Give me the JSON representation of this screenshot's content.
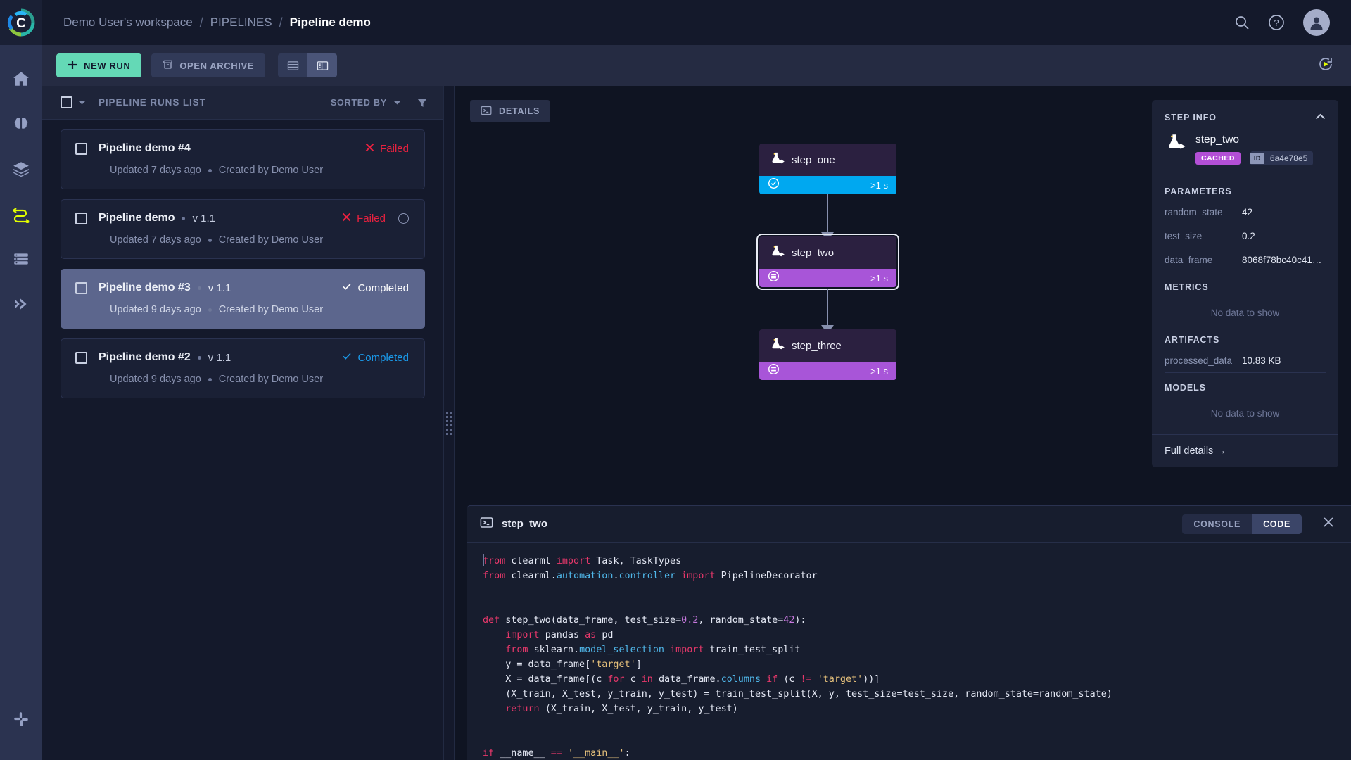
{
  "header": {
    "logo_icon": "clearml-logo-icon",
    "breadcrumb": [
      "Demo User's workspace",
      "PIPELINES",
      "Pipeline demo"
    ],
    "separator": "/",
    "search_icon": "search-icon",
    "help_icon": "help-circle-icon",
    "avatar_icon": "user-avatar-icon"
  },
  "rail": {
    "items": [
      {
        "name": "home",
        "icon": "home-icon",
        "active": false
      },
      {
        "name": "projects",
        "icon": "brain-icon",
        "active": false
      },
      {
        "name": "datasets",
        "icon": "layers-icon",
        "active": false
      },
      {
        "name": "pipelines",
        "icon": "pipelines-icon",
        "active": true
      },
      {
        "name": "workers",
        "icon": "server-icon",
        "active": false
      },
      {
        "name": "reports",
        "icon": "double-chevron-icon",
        "active": false
      }
    ],
    "bottom": {
      "name": "integrations",
      "icon": "slack-icon"
    }
  },
  "toolbar": {
    "new_run_label": "NEW RUN",
    "new_run_icon": "plus-icon",
    "open_archive_label": "OPEN ARCHIVE",
    "archive_icon": "archive-box-icon",
    "view_list_icon": "list-view-icon",
    "view_split_icon": "split-view-icon",
    "refresh_icon": "auto-refresh-icon"
  },
  "runs_panel": {
    "title": "PIPELINE RUNS LIST",
    "sorted_by_label": "SORTED BY",
    "sort_caret_icon": "chevron-down-icon",
    "filter_icon": "filter-icon",
    "select_all_icon": "checkbox-icon",
    "header_caret_icon": "chevron-down-icon",
    "runs": [
      {
        "name": "Pipeline demo #4",
        "version": "",
        "status": "Failed",
        "status_kind": "failed",
        "status_icon": "x-icon",
        "updated": "Updated 7 days ago",
        "created_by": "Created by Demo User",
        "selected": false,
        "spinner": false
      },
      {
        "name": "Pipeline demo",
        "version": "v 1.1",
        "status": "Failed",
        "status_kind": "failed",
        "status_icon": "x-icon",
        "updated": "Updated 7 days ago",
        "created_by": "Created by Demo User",
        "selected": false,
        "spinner": true
      },
      {
        "name": "Pipeline demo #3",
        "version": "v 1.1",
        "status": "Completed",
        "status_kind": "completed",
        "status_icon": "check-icon",
        "updated": "Updated 9 days ago",
        "created_by": "Created by Demo User",
        "selected": true,
        "spinner": false
      },
      {
        "name": "Pipeline demo #2",
        "version": "v 1.1",
        "status": "Completed",
        "status_kind": "completed",
        "status_icon": "check-icon",
        "updated": "Updated 9 days ago",
        "created_by": "Created by Demo User",
        "selected": false,
        "spinner": false
      }
    ]
  },
  "dag": {
    "details_label": "DETAILS",
    "details_icon": "console-icon",
    "nodes": [
      {
        "name": "step_one",
        "time": ">1 s",
        "bar_color": "#00a8f0",
        "bar_kind": "blue",
        "bar_icon": "check-circle-icon",
        "selected": false,
        "icon": "experiment-icon"
      },
      {
        "name": "step_two",
        "time": ">1 s",
        "bar_color": "#a855d8",
        "bar_kind": "purple",
        "bar_icon": "cached-icon",
        "selected": true,
        "icon": "experiment-icon"
      },
      {
        "name": "step_three",
        "time": ">1 s",
        "bar_color": "#a855d8",
        "bar_kind": "purple",
        "bar_icon": "cached-icon",
        "selected": false,
        "icon": "experiment-icon"
      }
    ]
  },
  "step_info": {
    "title": "STEP INFO",
    "collapse_icon": "chevron-up-icon",
    "task_icon": "experiment-icon",
    "task_name": "step_two",
    "badge": "CACHED",
    "badge_color": "#b34fd6",
    "id_key": "ID",
    "id_value": "6a4e78e5",
    "parameters_title": "PARAMETERS",
    "parameters": [
      {
        "key": "random_state",
        "value": "42"
      },
      {
        "key": "test_size",
        "value": "0.2"
      },
      {
        "key": "data_frame",
        "value": "8068f78bc40c41d…"
      }
    ],
    "metrics_title": "METRICS",
    "metrics_empty": "No data to show",
    "artifacts_title": "ARTIFACTS",
    "artifacts": [
      {
        "key": "processed_data",
        "value": "10.83 KB"
      }
    ],
    "models_title": "MODELS",
    "models_empty": "No data to show",
    "full_details_label": "Full details →"
  },
  "code_panel": {
    "icon": "console-icon",
    "title": "step_two",
    "tabs": [
      {
        "label": "CONSOLE",
        "active": false
      },
      {
        "label": "CODE",
        "active": true
      }
    ],
    "close_icon": "close-icon",
    "lines": [
      [
        {
          "t": "from ",
          "c": "kw"
        },
        {
          "t": "clearml ",
          "c": ""
        },
        {
          "t": "import ",
          "c": "kw"
        },
        {
          "t": "Task, TaskTypes",
          "c": ""
        }
      ],
      [
        {
          "t": "from ",
          "c": "kw"
        },
        {
          "t": "clearml.",
          "c": ""
        },
        {
          "t": "automation",
          "c": "mod"
        },
        {
          "t": ".",
          "c": ""
        },
        {
          "t": "controller ",
          "c": "mod"
        },
        {
          "t": "import ",
          "c": "kw"
        },
        {
          "t": "PipelineDecorator",
          "c": ""
        }
      ],
      [],
      [],
      [
        {
          "t": "def ",
          "c": "kw"
        },
        {
          "t": "step_two(data_frame, test_size=",
          "c": ""
        },
        {
          "t": "0.2",
          "c": "num"
        },
        {
          "t": ", random_state=",
          "c": ""
        },
        {
          "t": "42",
          "c": "num"
        },
        {
          "t": "):",
          "c": ""
        }
      ],
      [
        {
          "t": "    ",
          "c": ""
        },
        {
          "t": "import ",
          "c": "kw"
        },
        {
          "t": "pandas ",
          "c": ""
        },
        {
          "t": "as ",
          "c": "kw"
        },
        {
          "t": "pd",
          "c": ""
        }
      ],
      [
        {
          "t": "    ",
          "c": ""
        },
        {
          "t": "from ",
          "c": "kw"
        },
        {
          "t": "sklearn.",
          "c": ""
        },
        {
          "t": "model_selection ",
          "c": "mod"
        },
        {
          "t": "import ",
          "c": "kw"
        },
        {
          "t": "train_test_split",
          "c": ""
        }
      ],
      [
        {
          "t": "    y = data_frame[",
          "c": ""
        },
        {
          "t": "'target'",
          "c": "str"
        },
        {
          "t": "]",
          "c": ""
        }
      ],
      [
        {
          "t": "    X = data_frame[(c ",
          "c": ""
        },
        {
          "t": "for ",
          "c": "kw"
        },
        {
          "t": "c ",
          "c": ""
        },
        {
          "t": "in ",
          "c": "kw"
        },
        {
          "t": "data_frame.",
          "c": ""
        },
        {
          "t": "columns ",
          "c": "mod"
        },
        {
          "t": "if ",
          "c": "kw"
        },
        {
          "t": "(c ",
          "c": ""
        },
        {
          "t": "!= ",
          "c": "kw"
        },
        {
          "t": "'target'",
          "c": "str"
        },
        {
          "t": "))]",
          "c": ""
        }
      ],
      [
        {
          "t": "    (X_train, X_test, y_train, y_test) = train_test_split(X, y, test_size=test_size, random_state=random_state)",
          "c": ""
        }
      ],
      [
        {
          "t": "    ",
          "c": ""
        },
        {
          "t": "return ",
          "c": "kw"
        },
        {
          "t": "(X_train, X_test, y_train, y_test)",
          "c": ""
        }
      ],
      [],
      [],
      [
        {
          "t": "if ",
          "c": "kw"
        },
        {
          "t": "__name__ ",
          "c": ""
        },
        {
          "t": "== ",
          "c": "kw"
        },
        {
          "t": "'__main__'",
          "c": "str"
        },
        {
          "t": ":",
          "c": ""
        }
      ]
    ]
  }
}
